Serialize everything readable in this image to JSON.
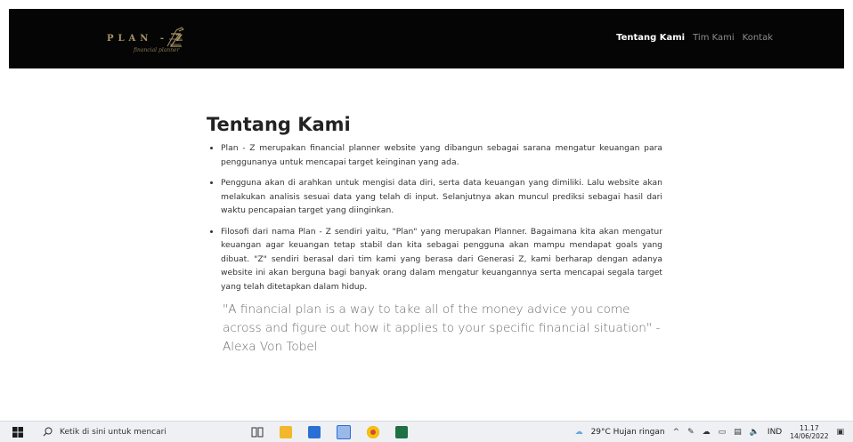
{
  "brand": {
    "name": "PLAN - Z",
    "tagline": "financial planner"
  },
  "nav": {
    "items": [
      {
        "label": "Tentang Kami",
        "active": true
      },
      {
        "label": "Tim Kami",
        "active": false
      },
      {
        "label": "Kontak",
        "active": false
      }
    ]
  },
  "main": {
    "title": "Tentang Kami",
    "bullets": [
      "Plan - Z merupakan financial planner website yang dibangun sebagai sarana mengatur keuangan para penggunanya untuk mencapai target keinginan yang ada.",
      "Pengguna akan di arahkan untuk mengisi data diri, serta data keuangan yang dimiliki. Lalu website akan melakukan analisis sesuai data yang telah di input. Selanjutnya akan muncul prediksi sebagai hasil dari waktu pencapaian target yang diinginkan.",
      "Filosofi dari nama Plan - Z sendiri yaitu, \"Plan\" yang merupakan Planner. Bagaimana kita akan mengatur keuangan agar keuangan tetap stabil dan kita sebagai pengguna akan mampu mendapat goals yang dibuat. \"Z\" sendiri berasal dari tim kami yang berasa dari Generasi Z, kami berharap dengan adanya website ini akan berguna bagi banyak orang dalam mengatur keuangannya serta mencapai segala target yang telah ditetapkan dalam hidup."
    ],
    "quote": "\"A financial plan is a way to take all of the money advice you come across and figure out how it applies to your specific financial situation\" - Alexa Von Tobel"
  },
  "taskbar": {
    "search_placeholder": "Ketik di sini untuk mencari",
    "weather": "29°C  Hujan ringan",
    "language": "IND",
    "time": "11.17",
    "date": "14/06/2022",
    "colors": {
      "explorer": "#f3b72c",
      "chrome": "#db4437",
      "excel": "#1e7145",
      "blue": "#2b6fd6"
    }
  }
}
